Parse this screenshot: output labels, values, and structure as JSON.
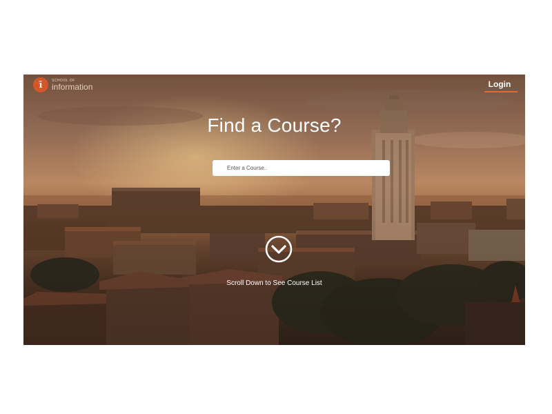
{
  "header": {
    "logo": {
      "small_text": "SCHOOL OF",
      "large_text": "information",
      "icon": "i-monogram-icon",
      "badge_color": "#d2572a"
    },
    "login_label": "Login",
    "accent_color": "#e06c37"
  },
  "hero": {
    "title": "Find a Course?",
    "search": {
      "placeholder": "Enter a Course..",
      "value": ""
    },
    "scroll_icon": "chevron-down-circle-icon",
    "scroll_label": "Scroll Down to See Course List"
  }
}
